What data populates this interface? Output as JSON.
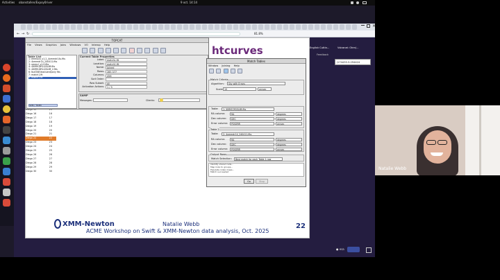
{
  "system": {
    "activities": "Activities",
    "app": "obanstallen/Expoy0river",
    "datetime": "9 oct. 14:14"
  },
  "browser": {
    "zoom": "81.8%",
    "bookmarks": [
      "English Cuttin...",
      "Vstranei: Ohm/..."
    ],
    "feedback": "Feedback",
    "coords_box": "J174433.3-294424"
  },
  "slide": {
    "title": "htcurves",
    "footer_logo": "XMM-Newton",
    "footer_name": "Natalie Webb",
    "footer_subtitle": "ACME Workshop on Swift & XMM-Newton data analysis, Oct. 2025",
    "page_number": "22",
    "obs_rows": [
      {
        "label": "Diego 15",
        "value": "15",
        "hl": false
      },
      {
        "label": "Diego 16",
        "value": "16",
        "hl": false
      },
      {
        "label": "Diego 17",
        "value": "17",
        "hl": false
      },
      {
        "label": "Diego 18",
        "value": "18",
        "hl": false
      },
      {
        "label": "Diego 19",
        "value": "19",
        "hl": false
      },
      {
        "label": "Diego 20",
        "value": "20",
        "hl": false
      },
      {
        "label": "Diego 21",
        "value": "21",
        "hl": false
      },
      {
        "label": "Diego 22",
        "value": "22",
        "hl": true
      },
      {
        "label": "Diego 23",
        "value": "23",
        "hl": false
      },
      {
        "label": "Diego 24",
        "value": "24",
        "hl": false
      },
      {
        "label": "Diego 25",
        "value": "25",
        "hl": false
      },
      {
        "label": "Diego 26",
        "value": "26",
        "hl": false
      },
      {
        "label": "Diego 27",
        "value": "27",
        "hl": false
      },
      {
        "label": "Diego 28",
        "value": "28",
        "hl": false
      },
      {
        "label": "Diego 29",
        "value": "29",
        "hl": false
      },
      {
        "label": "Diego 30",
        "value": "30",
        "hl": false
      }
    ]
  },
  "topcat": {
    "title": "TOPCAT",
    "menu": [
      "File",
      "Views",
      "Graphics",
      "Joins",
      "Windows",
      "VO",
      "Interop",
      "Help"
    ],
    "table_list_title": "Table List",
    "tables": [
      "1: emmock_v1.2_4xmmdr14s.fits",
      "2: 4xmmdr14_240411.fits",
      "3: xmmcl_v1.0.fits",
      "4: 4XMM-DR14/SLIM.fits",
      "5: 4XMM-DR14/SLIM_2.fits",
      "6: NuSTAR/transient/only fits",
      "7: match1.fit",
      "8: match1.fit"
    ],
    "selected_index": 7,
    "props_title": "Current Table Properties",
    "props": [
      {
        "k": "Label:",
        "v": "matchL.fit"
      },
      {
        "k": "Location:",
        "v": "match1.fit"
      },
      {
        "k": "Name:",
        "v": "Joined"
      },
      {
        "k": "Rows:",
        "v": "285 377"
      },
      {
        "k": "Columns:",
        "v": "456"
      },
      {
        "k": "Sort Order:",
        "v": ""
      },
      {
        "k": "Row Subset:",
        "v": "All"
      },
      {
        "k": "Activation Actions:",
        "v": "1 / 3"
      }
    ],
    "samp_title": "SAMP",
    "messages_label": "Messages:",
    "clients_label": "Clients:",
    "memory": "32M / 764M"
  },
  "match": {
    "title": "Match Tables",
    "menu": [
      "Window",
      "Joining",
      "Help"
    ],
    "criteria_title": "Match Criteria",
    "algorithm_label": "Algorithm:",
    "algorithm_value": "Sky with Errors",
    "scale_label": "Scale:",
    "scale_value": "10",
    "scale_unit": "arcsec",
    "table1_title": "Table 1",
    "table1_label": "Table:",
    "table1_value": "1: XMMCOR/SLIM.fits",
    "table2_title": "Table 2",
    "table2_label": "Table:",
    "table2_value": "2: 4xmmdr14_240411.fits",
    "ra_label": "RA column:",
    "dec_label": "Dec column:",
    "err_label": "Error column:",
    "t1": {
      "ra": "RA",
      "dec": "DEC",
      "err": "POSERR"
    },
    "t2": {
      "ra": "RA",
      "dec": "DEC",
      "err": "POSERR"
    },
    "deg": "degrees",
    "arcsec": "arcsec",
    "output_title": "Output Rows",
    "match_sel_label": "Match Selection:",
    "match_sel_value": "Best match for each Table 1 row",
    "log_title": "Log",
    "log_lines": [
      "Identify shared cells...",
      "Map links to groups...",
      "Populate index maps...",
      "Match succeeded"
    ],
    "go_label": "Go",
    "stop_label": "Stop"
  },
  "webcam": {
    "name": "Natalie Webb"
  },
  "colors": {
    "slide_blue": "#1b2f7a",
    "highlight_orange": "#e07b2a",
    "title_purple": "#6b2a7a",
    "select_blue": "#2f5fb5"
  }
}
